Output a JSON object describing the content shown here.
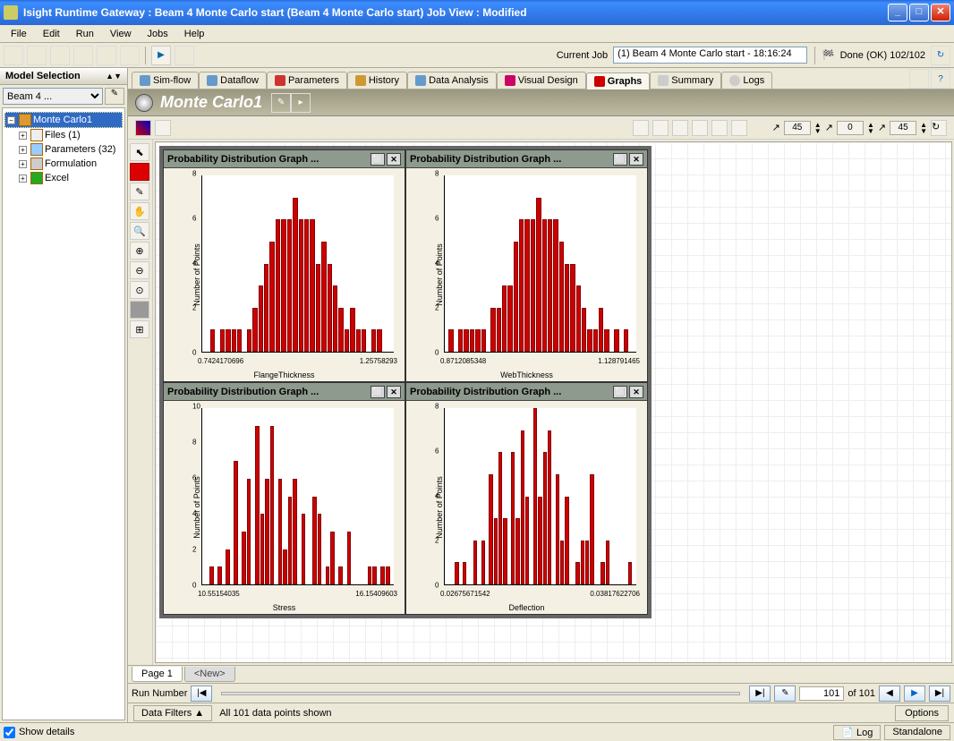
{
  "window": {
    "title": "Isight Runtime Gateway : Beam 4 Monte Carlo start (Beam 4 Monte Carlo start)  Job View : Modified"
  },
  "menu": {
    "items": [
      "File",
      "Edit",
      "Run",
      "View",
      "Jobs",
      "Help"
    ]
  },
  "currentjob": {
    "label": "Current Job",
    "value": "(1) Beam 4 Monte Carlo start - 18:16:24"
  },
  "done": {
    "text": "Done (OK) 102/102"
  },
  "sidebar": {
    "title": "Model Selection",
    "selector": "Beam 4 ...",
    "root": "Monte Carlo1",
    "nodes": [
      {
        "label": "Files (1)"
      },
      {
        "label": "Parameters (32)"
      },
      {
        "label": "Formulation"
      },
      {
        "label": "Excel"
      }
    ]
  },
  "tabs": [
    "Sim-flow",
    "Dataflow",
    "Parameters",
    "History",
    "Data Analysis",
    "Visual Design",
    "Graphs",
    "Summary",
    "Logs"
  ],
  "active_tab": 6,
  "component_header": "Monte Carlo1",
  "spinners": [
    "45",
    "0",
    "45"
  ],
  "chart_data": [
    {
      "type": "bar",
      "title": "Probability Distribution Graph ...",
      "xlabel": "FlangeThickness",
      "ylabel": "Number of Points",
      "xlim": [
        "0.7424170696",
        "1.25758293"
      ],
      "ylim": [
        0,
        8
      ],
      "yticks": [
        0,
        2,
        4,
        6,
        8
      ],
      "values": [
        0,
        1,
        0,
        1,
        1,
        1,
        1,
        0,
        1,
        2,
        3,
        4,
        5,
        6,
        6,
        6,
        7,
        6,
        6,
        6,
        4,
        5,
        4,
        3,
        2,
        1,
        2,
        1,
        1,
        0,
        1,
        1,
        0,
        0
      ]
    },
    {
      "type": "bar",
      "title": "Probability Distribution Graph ...",
      "xlabel": "WebThickness",
      "ylabel": "Number of Points",
      "xlim": [
        "0.8712085348",
        "1.128791465"
      ],
      "ylim": [
        0,
        8
      ],
      "yticks": [
        0,
        2,
        4,
        6,
        8
      ],
      "values": [
        1,
        0,
        1,
        1,
        1,
        1,
        1,
        0,
        2,
        2,
        3,
        3,
        5,
        6,
        6,
        6,
        7,
        6,
        6,
        6,
        5,
        4,
        4,
        3,
        2,
        1,
        1,
        2,
        1,
        0,
        1,
        0,
        1,
        0
      ]
    },
    {
      "type": "bar",
      "title": "Probability Distribution Graph ...",
      "xlabel": "Stress",
      "ylabel": "Number of Points",
      "xlim": [
        "10.55154035",
        "16.15409603"
      ],
      "ylim": [
        0,
        10
      ],
      "yticks": [
        0,
        2,
        4,
        6,
        8,
        10
      ],
      "values": [
        0,
        1,
        0,
        1,
        0,
        2,
        0,
        7,
        0,
        3,
        6,
        0,
        9,
        4,
        6,
        9,
        0,
        6,
        2,
        5,
        6,
        0,
        4,
        0,
        0,
        5,
        4,
        0,
        1,
        3,
        0,
        1,
        0,
        3,
        0,
        0,
        0,
        0,
        0,
        1,
        1,
        0,
        1,
        1
      ]
    },
    {
      "type": "bar",
      "title": "Probability Distribution Graph ...",
      "xlabel": "Deflection",
      "ylabel": "Number of Points",
      "xlim": [
        "0.02675671542",
        "0.03817622706"
      ],
      "ylim": [
        0,
        8
      ],
      "yticks": [
        0,
        2,
        4,
        6,
        8
      ],
      "values": [
        0,
        0,
        1,
        0,
        1,
        0,
        0,
        2,
        0,
        2,
        0,
        5,
        3,
        6,
        3,
        0,
        6,
        3,
        7,
        4,
        0,
        8,
        4,
        6,
        7,
        0,
        5,
        2,
        4,
        0,
        0,
        1,
        2,
        2,
        5,
        0,
        0,
        1,
        2,
        0,
        0,
        0,
        0,
        0,
        0,
        1
      ]
    }
  ],
  "pages": {
    "current": "Page 1",
    "new": "<New>"
  },
  "runbar": {
    "label": "Run Number",
    "current": "101",
    "total": "of 101"
  },
  "filter": {
    "btn": "Data Filters ▲",
    "text": "All 101 data points shown",
    "options": "Options"
  },
  "status": {
    "show": "Show details",
    "log": "Log",
    "mode": "Standalone"
  }
}
